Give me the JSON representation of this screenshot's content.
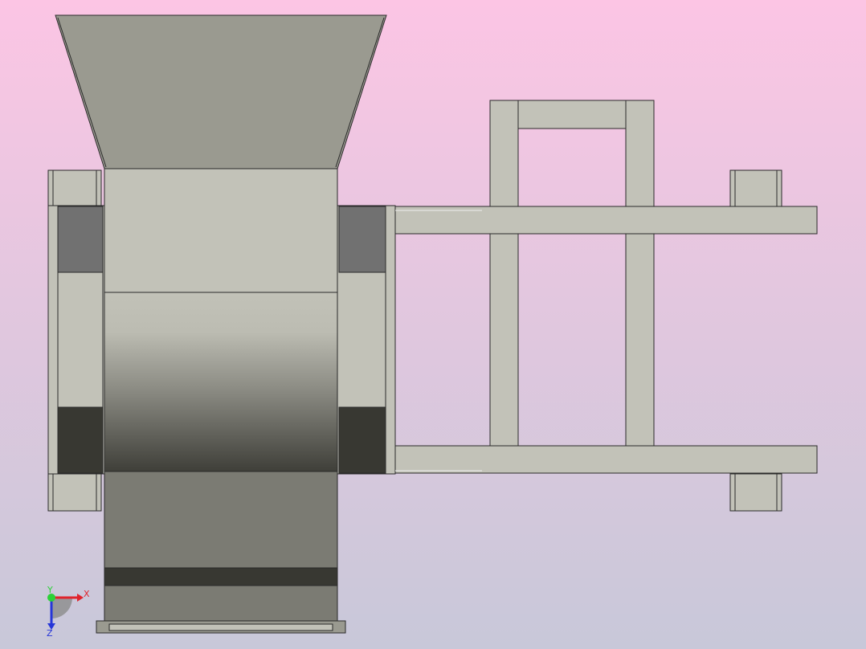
{
  "viewport": {
    "background_top": "#fcc5e4",
    "background_bottom": "#c8c8d9"
  },
  "colors": {
    "part_light": "#c2c2b8",
    "part_mid": "#9a9a90",
    "part_dark": "#7b7b73",
    "part_darker": "#717171",
    "part_darkest": "#383832",
    "edge": "#2a2a2a",
    "axis_x": "#e0232c",
    "axis_y": "#2bd137",
    "axis_z": "#2636d8"
  },
  "triad": {
    "x_label": "X",
    "y_label": "Y",
    "z_label": "Z"
  }
}
